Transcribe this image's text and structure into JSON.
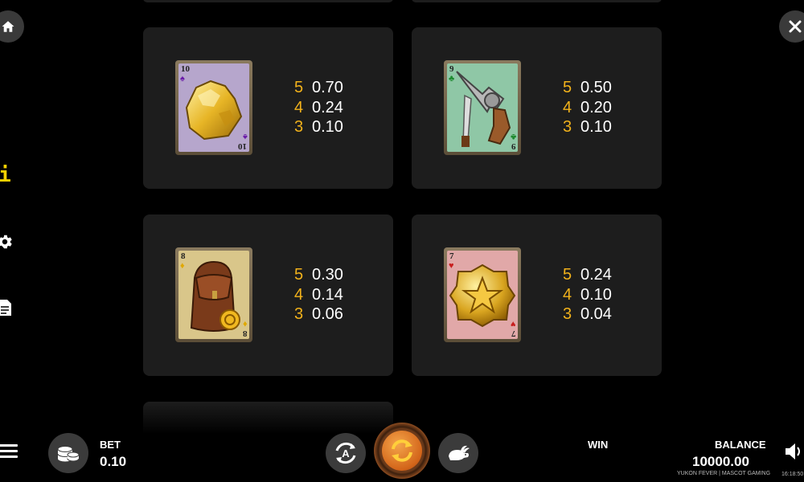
{
  "paytable": [
    {
      "symbol": "gold-nugget-card",
      "rank": "10",
      "suit": "spade",
      "suit_glyph": "♠",
      "suit_color": "#6a1aa8",
      "card_bg": "#b6a6cc",
      "pays": [
        {
          "count": "5",
          "value": "0.70"
        },
        {
          "count": "4",
          "value": "0.24"
        },
        {
          "count": "3",
          "value": "0.10"
        }
      ]
    },
    {
      "symbol": "revolver-card",
      "rank": "9",
      "suit": "club",
      "suit_glyph": "♣",
      "suit_color": "#1c8a2e",
      "card_bg": "#8fc7a6",
      "pays": [
        {
          "count": "5",
          "value": "0.50"
        },
        {
          "count": "4",
          "value": "0.20"
        },
        {
          "count": "3",
          "value": "0.10"
        }
      ]
    },
    {
      "symbol": "backpack-card",
      "rank": "8",
      "suit": "diamond",
      "suit_glyph": "♦",
      "suit_color": "#e0a800",
      "card_bg": "#d9c68a",
      "pays": [
        {
          "count": "5",
          "value": "0.30"
        },
        {
          "count": "4",
          "value": "0.14"
        },
        {
          "count": "3",
          "value": "0.06"
        }
      ]
    },
    {
      "symbol": "sheriff-badge-card",
      "rank": "7",
      "suit": "heart",
      "suit_glyph": "♥",
      "suit_color": "#c81e1e",
      "card_bg": "#e1a8a8",
      "pays": [
        {
          "count": "5",
          "value": "0.24"
        },
        {
          "count": "4",
          "value": "0.10"
        },
        {
          "count": "3",
          "value": "0.04"
        }
      ]
    }
  ],
  "bottom_bar": {
    "bet_label": "BET",
    "bet_value": "0.10",
    "win_label": "WIN",
    "balance_label": "BALANCE",
    "balance_value": "10000.00",
    "footer": "YUKON FEVER | MASCOT GAMING",
    "clock": "16:18:50",
    "autoplay_letter": "A"
  },
  "side_icons": {
    "info_glyph": "i"
  },
  "colors": {
    "accent": "#f2b21b",
    "panel": "#1d1d1d",
    "button": "#3b3b3b"
  }
}
